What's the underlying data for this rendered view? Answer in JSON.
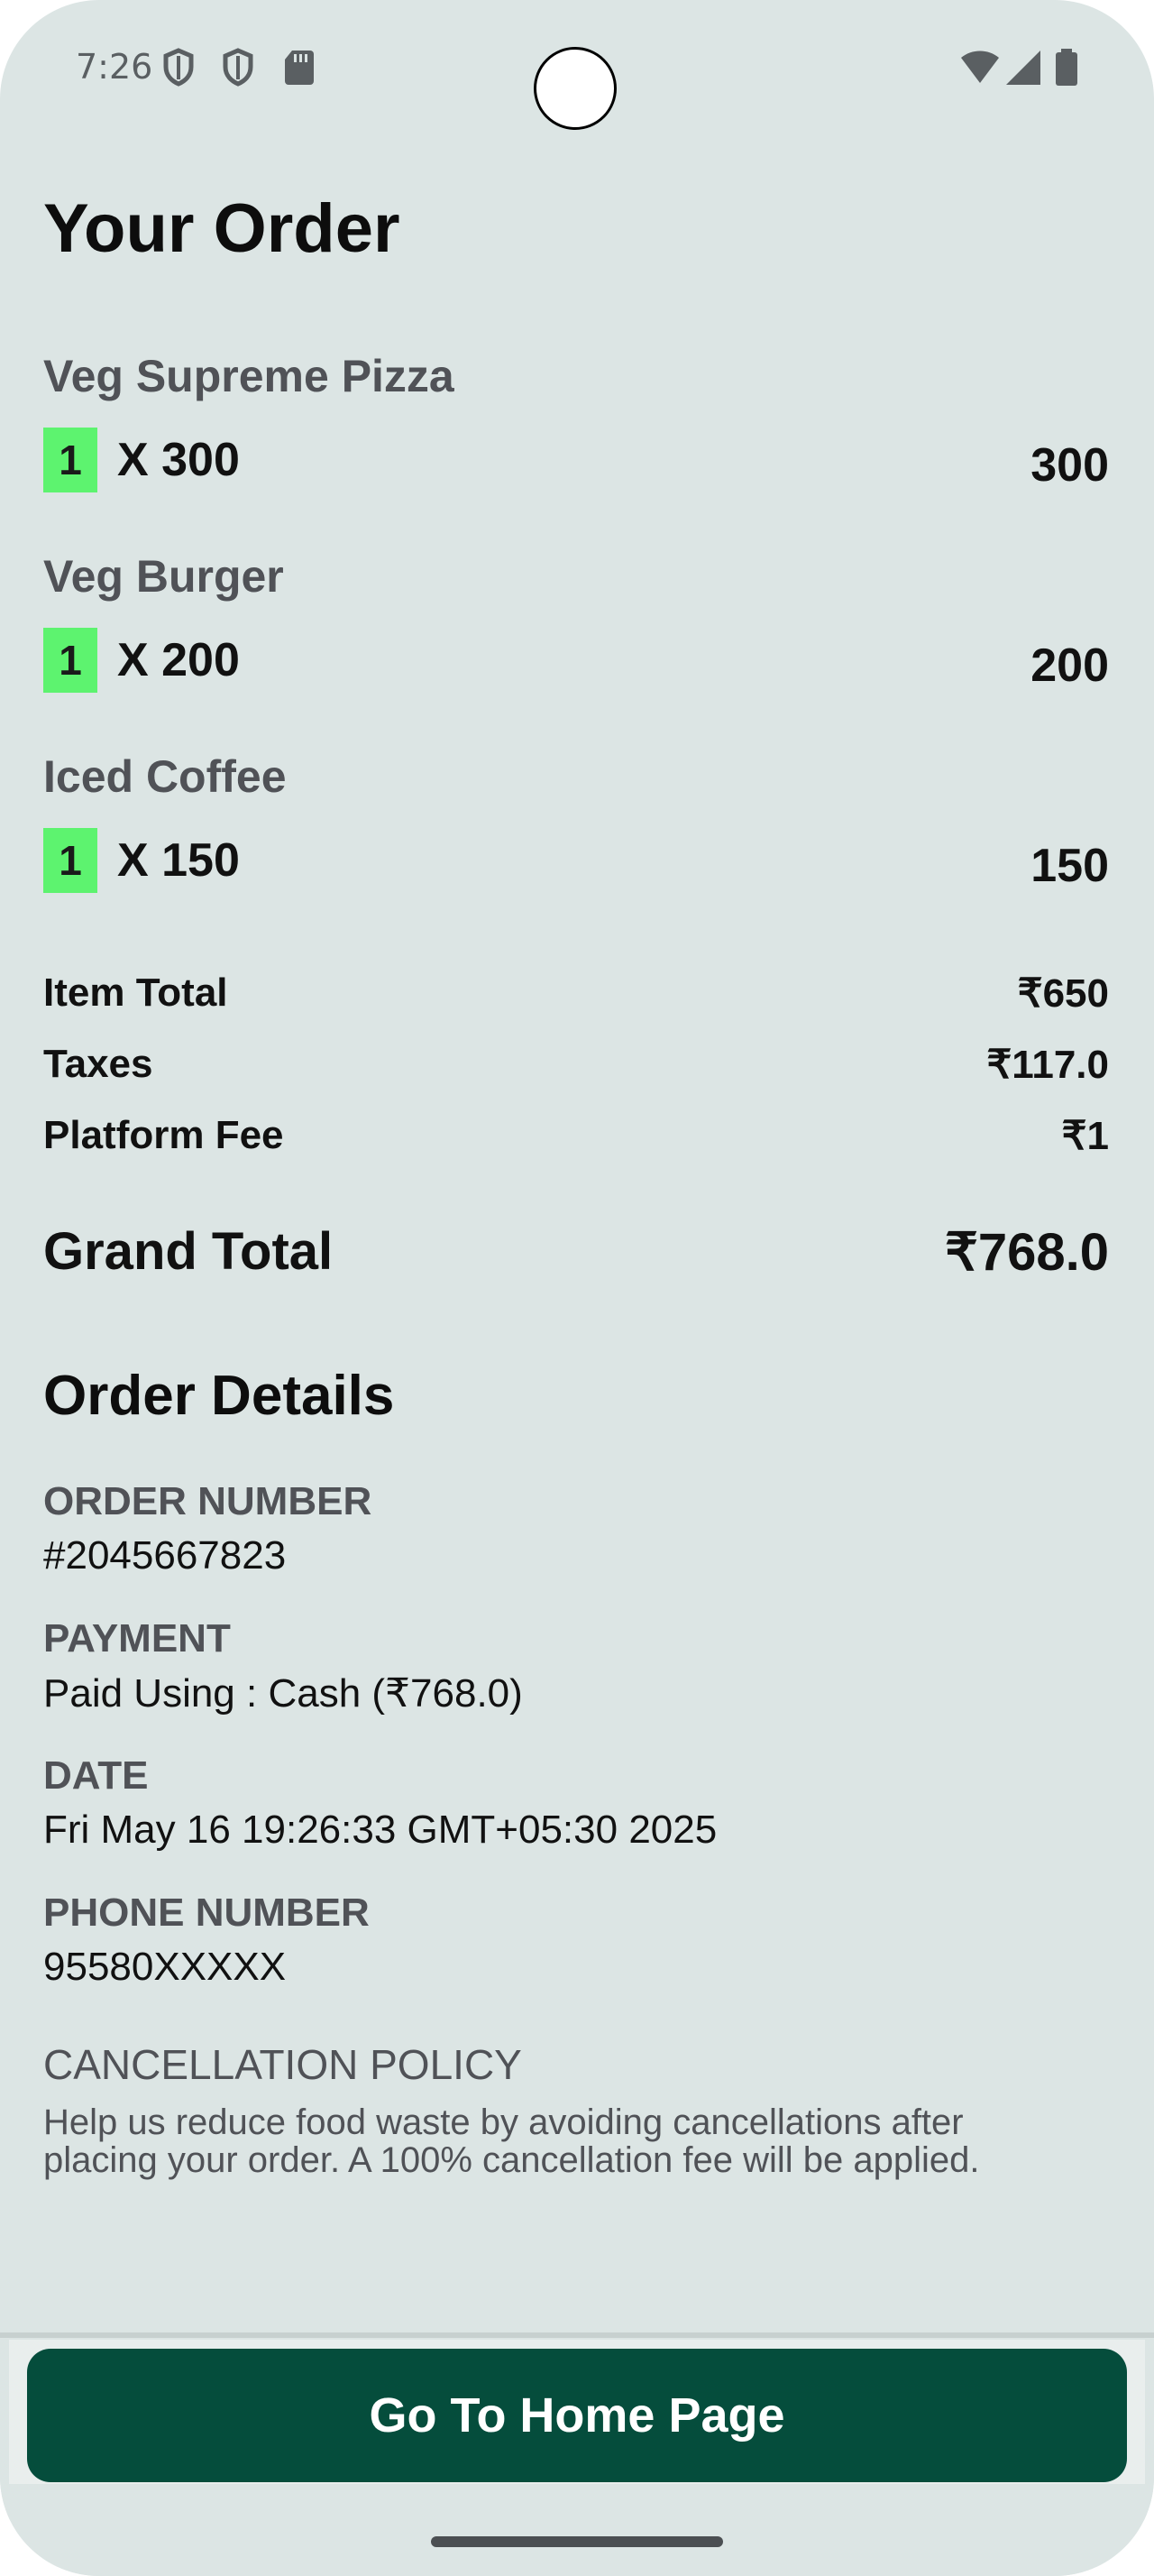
{
  "status_bar": {
    "time": "7:26"
  },
  "title": "Your Order",
  "items": [
    {
      "name": "Veg Supreme Pizza",
      "qty": "1",
      "unit": "X 300",
      "total": "300"
    },
    {
      "name": "Veg Burger",
      "qty": "1",
      "unit": "X 200",
      "total": "200"
    },
    {
      "name": "Iced Coffee",
      "qty": "1",
      "unit": "X 150",
      "total": "150"
    }
  ],
  "summary": {
    "item_total_label": "Item Total",
    "item_total": "₹650",
    "taxes_label": "Taxes",
    "taxes": "₹117.0",
    "platform_fee_label": "Platform Fee",
    "platform_fee": "₹1",
    "grand_total_label": "Grand Total",
    "grand_total": "₹768.0"
  },
  "details": {
    "title": "Order Details",
    "order_number_label": "ORDER NUMBER",
    "order_number": "#2045667823",
    "payment_label": "PAYMENT",
    "payment": "Paid Using : Cash (₹768.0)",
    "date_label": "DATE",
    "date": "Fri May 16 19:26:33 GMT+05:30 2025",
    "phone_label": "PHONE NUMBER",
    "phone": "95580XXXXX"
  },
  "cancellation": {
    "title": "CANCELLATION POLICY",
    "text": "Help us reduce food waste by avoiding cancellations after placing your order. A 100% cancellation fee will be applied."
  },
  "button": {
    "label": "Go To Home Page"
  },
  "colors": {
    "background": "#dce5e4",
    "accent": "#054d3c",
    "qty_badge": "#5df36f"
  }
}
